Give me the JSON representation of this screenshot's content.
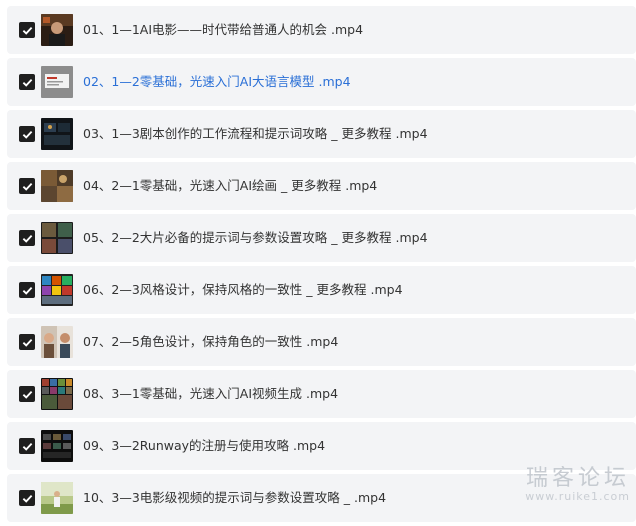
{
  "items": [
    {
      "label": "01、1—1AI电影——时代带给普通人的机会 .mp4",
      "checked": true,
      "active": false,
      "thumb": "thumb-person-dark"
    },
    {
      "label": "02、1—2零基础，光速入门AI大语言模型 .mp4",
      "checked": true,
      "active": true,
      "thumb": "thumb-slide-grey"
    },
    {
      "label": "03、1—3剧本创作的工作流程和提示词攻略 _ 更多教程 .mp4",
      "checked": true,
      "active": false,
      "thumb": "thumb-dark-scene"
    },
    {
      "label": "04、2—1零基础，光速入门AI绘画 _ 更多教程 .mp4",
      "checked": true,
      "active": false,
      "thumb": "thumb-art-warm"
    },
    {
      "label": "05、2—2大片必备的提示词与参数设置攻略 _ 更多教程 .mp4",
      "checked": true,
      "active": false,
      "thumb": "thumb-grid-photos"
    },
    {
      "label": "06、2—3风格设计，保持风格的一致性 _ 更多教程 .mp4",
      "checked": true,
      "active": false,
      "thumb": "thumb-colorful-grid"
    },
    {
      "label": "07、2—5角色设计，保持角色的一致性 .mp4",
      "checked": true,
      "active": false,
      "thumb": "thumb-portraits"
    },
    {
      "label": "08、3—1零基础，光速入门AI视频生成 .mp4",
      "checked": true,
      "active": false,
      "thumb": "thumb-mosaic"
    },
    {
      "label": "09、3—2Runway的注册与使用攻略 .mp4",
      "checked": true,
      "active": false,
      "thumb": "thumb-dark-ui"
    },
    {
      "label": "10、3—3电影级视频的提示词与参数设置攻略 _ .mp4",
      "checked": true,
      "active": false,
      "thumb": "thumb-outdoor"
    }
  ],
  "watermark": {
    "title": "瑞客论坛",
    "url": "www.ruike1.com"
  },
  "colors": {
    "row_bg": "#f3f4f6",
    "checkbox": "#1f1f1f",
    "text": "#333333",
    "active_text": "#2a6fd6"
  }
}
